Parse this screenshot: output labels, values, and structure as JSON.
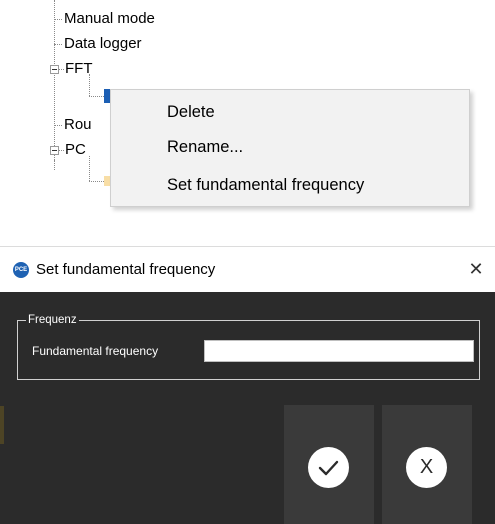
{
  "tree": {
    "items": [
      {
        "label": "Manual mode"
      },
      {
        "label": "Data logger"
      },
      {
        "label": "FFT"
      },
      {
        "label": ""
      },
      {
        "label": "Rou"
      },
      {
        "label": "PC"
      }
    ]
  },
  "context_menu": {
    "items": [
      {
        "label": "Delete"
      },
      {
        "label": "Rename..."
      },
      {
        "label": "Set fundamental frequency"
      }
    ]
  },
  "dialog": {
    "icon_text": "PCE",
    "title": "Set fundamental frequency",
    "close_glyph": "✕",
    "group_label": "Frequenz",
    "field_label": "Fundamental frequency",
    "field_value": "",
    "cancel_glyph": "X"
  },
  "colors": {
    "dialog_bg": "#2b2b2b",
    "button_bg": "#3a3a3a",
    "selection": "#1c5fb4"
  },
  "icons": [
    "expand-minus-icon",
    "app-logo-icon",
    "close-icon",
    "checkmark-icon",
    "cancel-x-icon"
  ]
}
